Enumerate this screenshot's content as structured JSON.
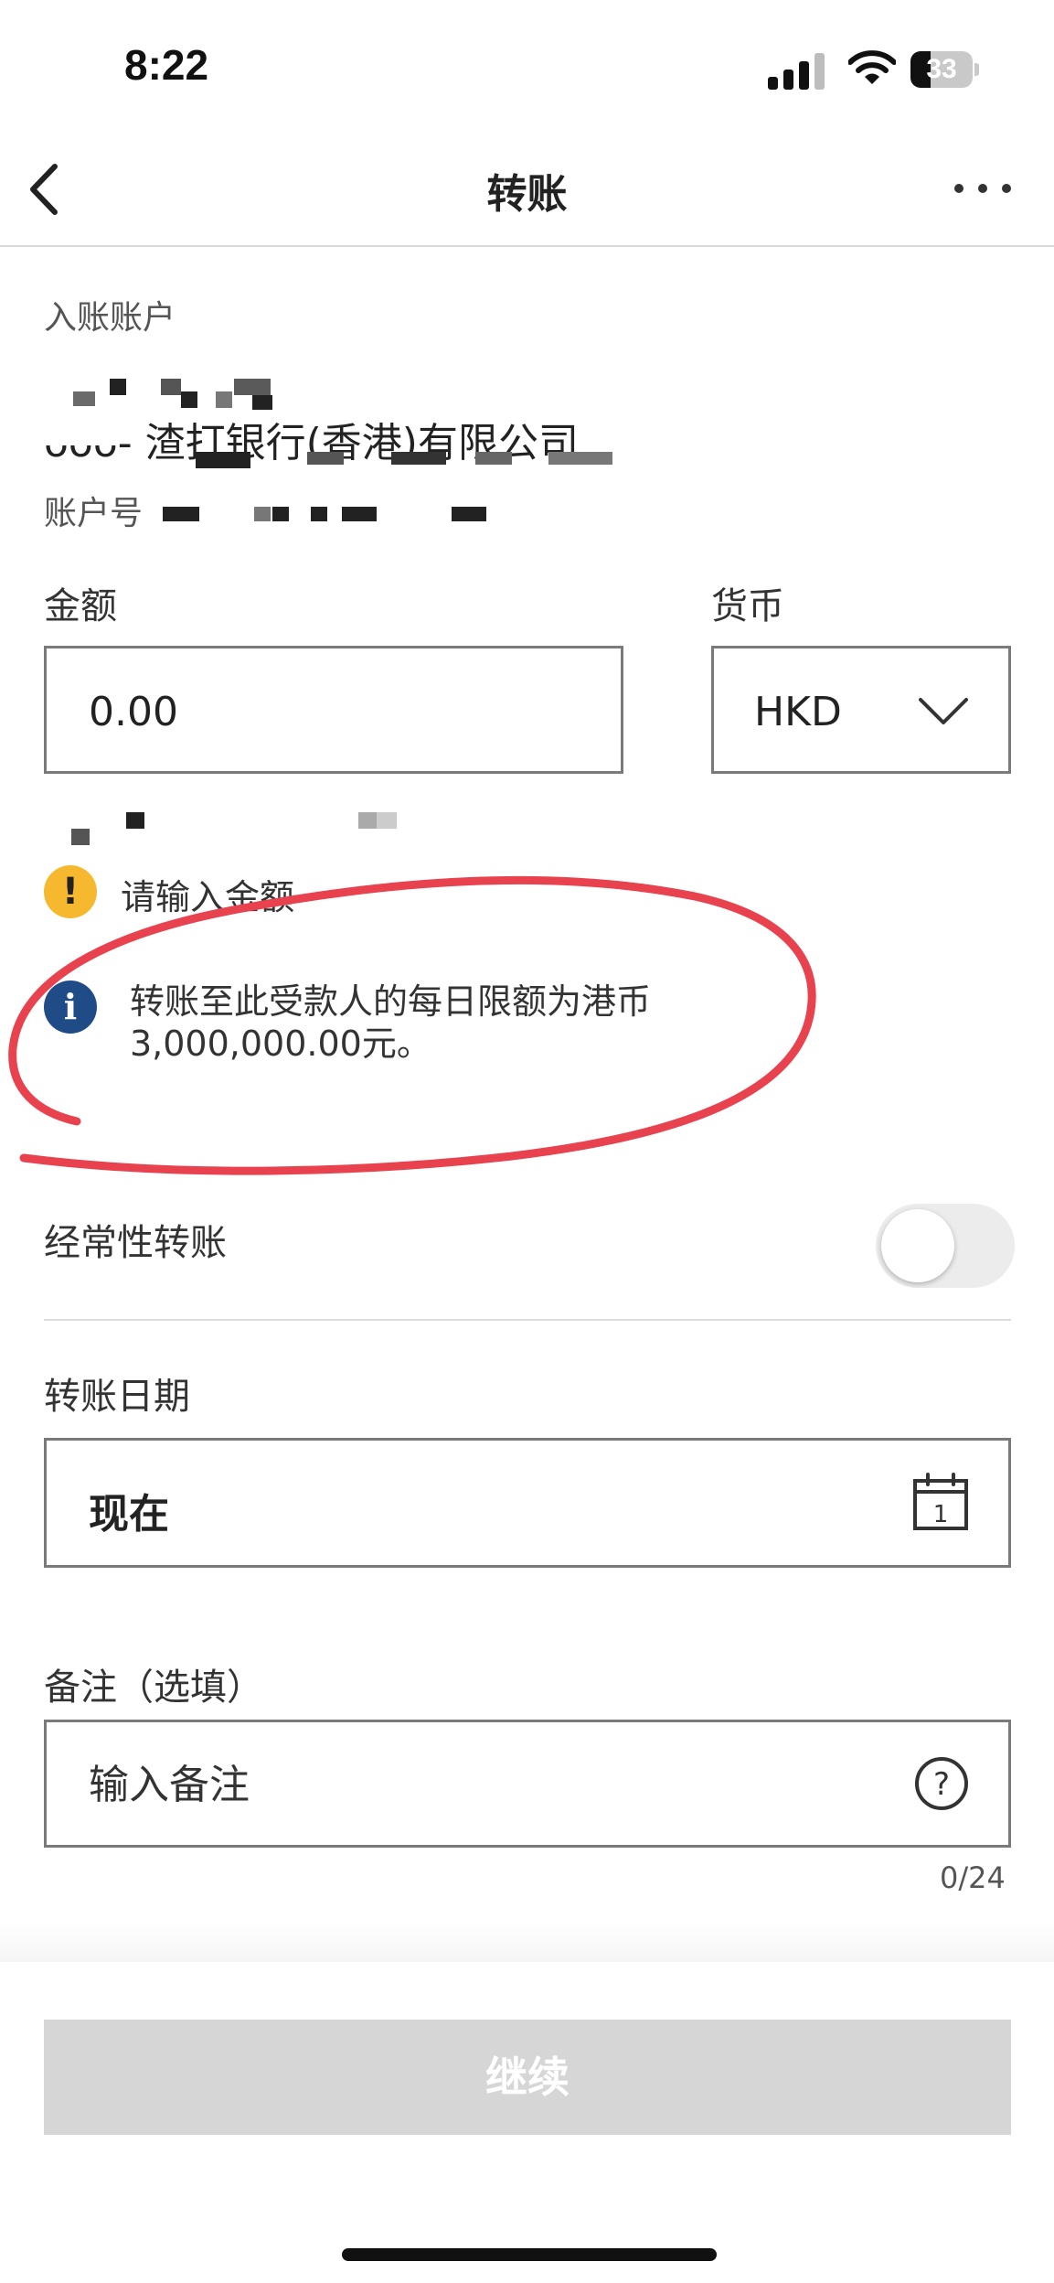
{
  "status_bar": {
    "time": "8:22",
    "battery": "33",
    "battery_level": 0.33
  },
  "nav": {
    "title": "转账"
  },
  "payee": {
    "section_label": "入账账户",
    "bank_name": "- 渣打银行(香港)有限公司",
    "bank_code_partial": "ᴗᴗᴗ",
    "account_label": "账户号"
  },
  "amount": {
    "label": "金额",
    "value": "0.00"
  },
  "currency": {
    "label": "货币",
    "value": "HKD"
  },
  "warning": {
    "text": "请输入金额"
  },
  "info": {
    "line1": "转账至此受款人的每日限额为港币",
    "line2": "3,000,000.00元。"
  },
  "recurring": {
    "label": "经常性转账",
    "enabled": false
  },
  "date": {
    "label": "转账日期",
    "value": "现在"
  },
  "remark": {
    "label": "备注（选填）",
    "placeholder": "输入备注",
    "counter": "0/24"
  },
  "continue_button": {
    "label": "继续"
  },
  "colors": {
    "warning": "#f5b82e",
    "info": "#1f4c86",
    "button_disabled": "#d6d6d6",
    "annotation": "#e8424f"
  }
}
